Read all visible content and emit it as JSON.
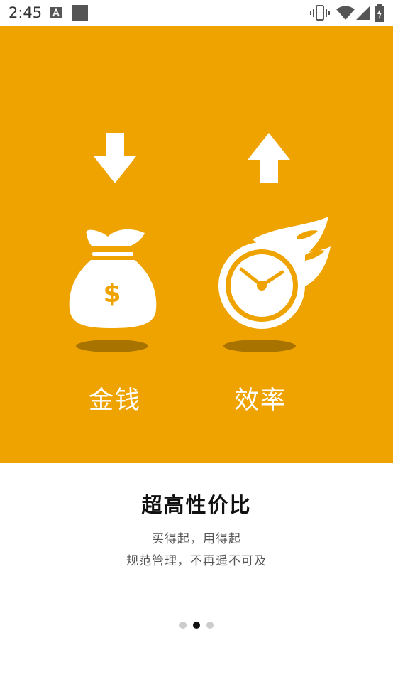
{
  "status_bar": {
    "time": "2:45",
    "icons": [
      "a-notification-icon",
      "square-notification-icon",
      "vibrate-icon",
      "wifi-icon",
      "signal-icon",
      "battery-icon"
    ]
  },
  "hero": {
    "background_color": "#EEA300",
    "money_label": "金钱",
    "efficiency_label": "效率",
    "icons": [
      "arrow-down-icon",
      "arrow-up-icon",
      "money-bag-icon",
      "clock-icon"
    ]
  },
  "intro": {
    "title": "超高性价比",
    "line1": "买得起，用得起",
    "line2": "规范管理，不再遥不可及"
  },
  "pager": {
    "pages": 3,
    "active_index": 1
  }
}
